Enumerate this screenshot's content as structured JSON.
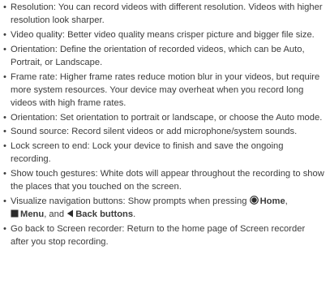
{
  "items": [
    "Resolution: You can record videos with different resolution. Videos with higher resolution look sharper.",
    "Video quality: Better video quality means crisper picture and bigger file size.",
    "Orientation: Define the orientation of recorded videos, which can be Auto, Portrait, or Landscape.",
    "Frame rate: Higher frame rates reduce motion blur in your videos, but require more system resources. Your device may overheat when you record long videos with high frame rates.",
    "Orientation: Set orientation to portrait or landscape, or choose the Auto mode.",
    "Sound source: Record silent videos or add microphone/system sounds.",
    "Lock screen to end: Lock your device to finish and save the ongoing recording.",
    "Show touch gestures: White dots will appear throughout the recording to show the places that you touched on the screen."
  ],
  "nav_item": {
    "prefix": "Visualize navigation buttons: Show prompts when pressing",
    "home_icon": "home-circle-icon",
    "home_label": "Home",
    "comma": ",",
    "menu_icon": "menu-square-icon",
    "menu_label": "Menu",
    "and": ", and",
    "back_icon": "back-triangle-icon",
    "back_label": "Back buttons",
    "period": "."
  },
  "last_item": "Go back to Screen recorder: Return to the home page of Screen recorder after you stop recording."
}
